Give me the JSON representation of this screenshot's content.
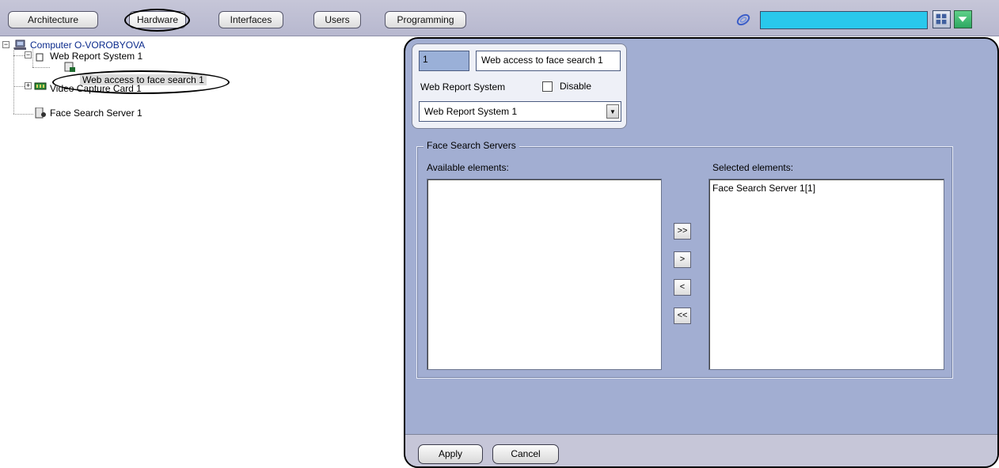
{
  "toolbar": {
    "tabs": [
      {
        "label": "Architecture"
      },
      {
        "label": "Hardware"
      },
      {
        "label": "Interfaces"
      },
      {
        "label": "Users"
      },
      {
        "label": "Programming"
      }
    ],
    "active_tab": "Hardware",
    "search_color": "#29c8ec"
  },
  "tree": {
    "items": [
      {
        "label": "Computer O-VOROBYOVA",
        "icon": "computer-icon"
      },
      {
        "label": "Web Report System 1",
        "icon": "folder-icon"
      },
      {
        "label": "Web access to face search 1",
        "icon": "web-access-icon"
      },
      {
        "label": "Video Capture Card 1",
        "icon": "capture-card-icon"
      },
      {
        "label": "Face Search Server 1",
        "icon": "server-icon"
      }
    ]
  },
  "settings": {
    "id_value": "1",
    "name_value": "Web access to face search 1",
    "parent_label": "Web Report System",
    "disable_label": "Disable",
    "disable_checked": false,
    "parent_selected": "Web Report System 1",
    "group_title": "Face Search Servers",
    "available_caption": "Available elements:",
    "selected_caption": "Selected elements:",
    "available_items": [],
    "selected_items": [
      "Face Search Server 1[1]"
    ],
    "move_buttons": [
      ">>",
      ">",
      "<",
      "<<"
    ],
    "apply_label": "Apply",
    "cancel_label": "Cancel"
  }
}
